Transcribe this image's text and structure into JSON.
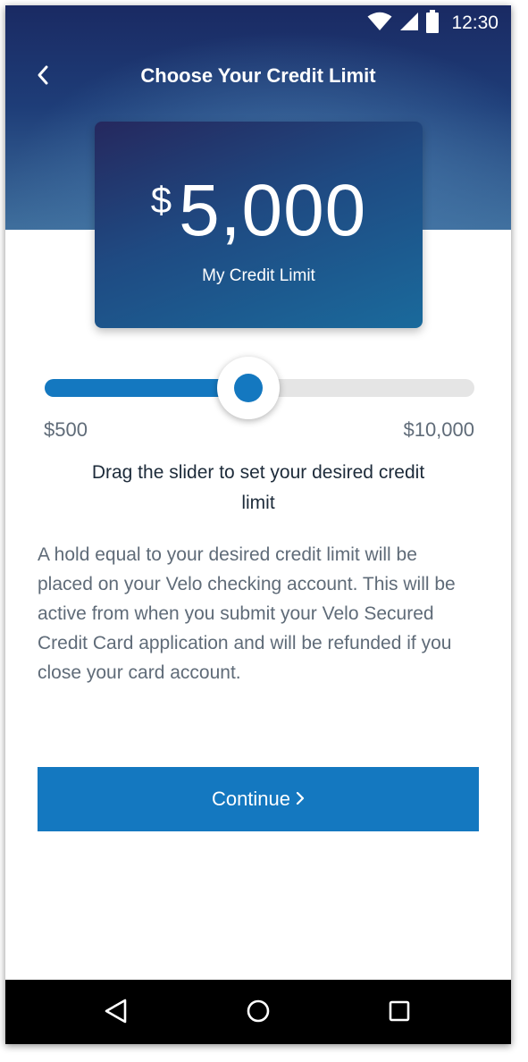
{
  "status_bar": {
    "time": "12:30",
    "icons": [
      "wifi-icon",
      "cellular-signal-icon",
      "battery-icon"
    ]
  },
  "app_bar": {
    "title": "Choose Your Credit Limit",
    "back_icon": "chevron-left-icon"
  },
  "credit_card": {
    "currency_symbol": "$",
    "amount": "5,000",
    "label": "My Credit Limit"
  },
  "slider": {
    "min_label": "$500",
    "max_label": "$10,000",
    "min_value": 500,
    "max_value": 10000,
    "value": 5000,
    "fill_color": "#1478c0",
    "track_color": "#e5e5e5"
  },
  "instruction": "Drag the slider to set your desired credit limit",
  "disclosure": "A hold equal to your desired credit limit will be placed on your Velo checking account. This will be active from when you submit your Velo Secured Credit Card application and will be refunded if you close your card account.",
  "continue_button": {
    "label": "Continue",
    "icon": "chevron-right-icon",
    "color": "#1478c0"
  },
  "nav_bar": {
    "buttons": [
      "back-triangle-icon",
      "home-circle-icon",
      "recents-square-icon"
    ]
  }
}
